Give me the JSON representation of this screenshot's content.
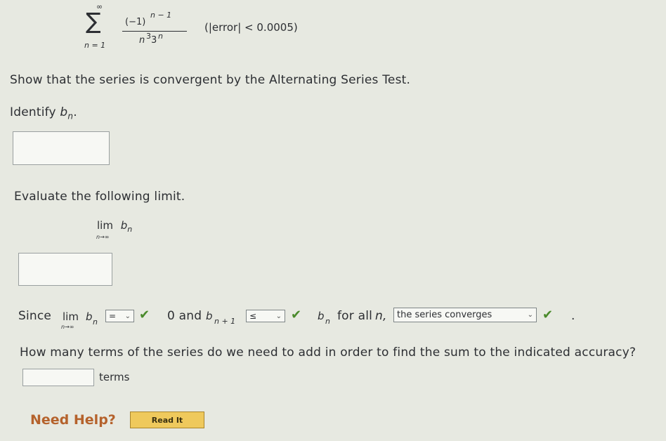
{
  "series": {
    "sum_symbol": "∑",
    "upper_limit": "∞",
    "lower_limit": "n = 1",
    "numerator_base": "(−1)",
    "numerator_exp": "n − 1",
    "denominator_n": "n",
    "denominator_n_exp": "3",
    "denominator_base": "3",
    "denominator_exp": "n",
    "error_condition": "(|error| < 0.0005)"
  },
  "question1": {
    "text": "Show that the series is convergent by the Alternating Series Test."
  },
  "question2": {
    "prefix": "Identify ",
    "b": "b",
    "sub": "n",
    "suffix": "."
  },
  "question3": {
    "text": "Evaluate the following limit.",
    "lim": "lim",
    "lim_sub": "n→∞",
    "b": "b",
    "sub": "n"
  },
  "since_line": {
    "since": "Since",
    "lim": "lim",
    "lim_sub": "n→∞",
    "b": "b",
    "sub": "n",
    "select1": "=",
    "zero_and": "0 and",
    "b2": "b",
    "sub2": "n + 1",
    "select2": "≤",
    "b3": "b",
    "sub3": "n",
    "for_all": "for all",
    "n_var": "n,",
    "select3": "the series converges",
    "period": "."
  },
  "question4": {
    "text": "How many terms of the series do we need to add in order to find the sum to the indicated accuracy?",
    "unit": "terms"
  },
  "help": {
    "label": "Need Help?",
    "button": "Read It"
  },
  "icons": {
    "check": "check-icon",
    "dropdown": "chevron-down-icon"
  },
  "colors": {
    "check": "#4a8a2b",
    "help": "#b5622c",
    "button": "#efc95c"
  }
}
